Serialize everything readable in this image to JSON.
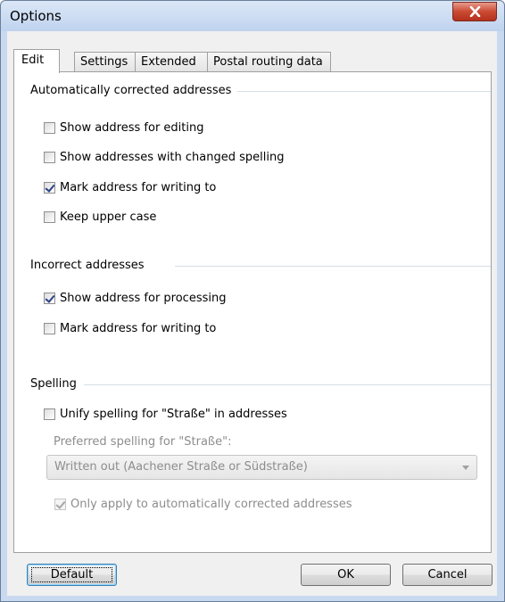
{
  "window": {
    "title": "Options"
  },
  "tabs": [
    {
      "label": "Edit",
      "active": true
    },
    {
      "label": "Settings",
      "active": false
    },
    {
      "label": "Extended",
      "active": false
    },
    {
      "label": "Postal routing data",
      "active": false
    }
  ],
  "groups": {
    "auto": {
      "label": "Automatically corrected addresses",
      "options": [
        {
          "label": "Show address for editing",
          "checked": false
        },
        {
          "label": "Show addresses with changed spelling",
          "checked": false
        },
        {
          "label": "Mark address for writing to",
          "checked": true
        },
        {
          "label": "Keep upper case",
          "checked": false
        }
      ]
    },
    "incorrect": {
      "label": "Incorrect addresses",
      "options": [
        {
          "label": "Show address for processing",
          "checked": true
        },
        {
          "label": "Mark address for writing to",
          "checked": false
        }
      ]
    },
    "spelling": {
      "label": "Spelling",
      "unify": {
        "label": "Unify spelling for \"Straße\" in addresses",
        "checked": false
      },
      "preferred_label": "Preferred spelling for \"Straße\":",
      "preferred_value": "Written out (Aachener Straße or Südstraße)",
      "only_apply": {
        "label": "Only apply to automatically corrected addresses",
        "checked": true,
        "disabled": true
      }
    }
  },
  "buttons": {
    "default": "Default",
    "ok": "OK",
    "cancel": "Cancel"
  },
  "colors": {
    "close_button": "#c94a33",
    "group_line": "#d5dfe5",
    "check_mark": "#2a3f88"
  }
}
